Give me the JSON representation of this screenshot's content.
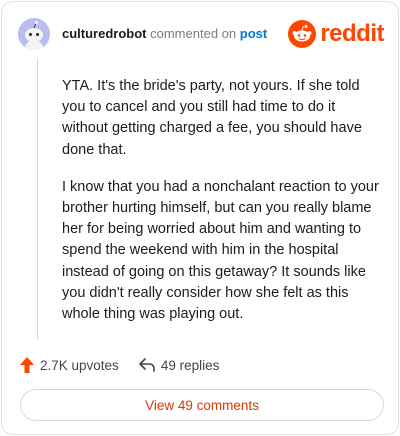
{
  "comment": {
    "username": "culturedrobot",
    "action_text": "commented on",
    "target_text": "post",
    "paragraphs": [
      "YTA. It's the bride's party, not yours. If she told you to cancel and you still had time to do it without getting charged a fee, you should have done that.",
      "I know that you had a nonchalant reaction to your brother hurting himself, but can you really blame her for being worried about him and wanting to spend the weekend with him in the hospital instead of going on this getaway? It sounds like you didn't really consider how she felt as this whole thing was playing out."
    ]
  },
  "brand": {
    "wordmark": "reddit",
    "color": "#ff4500"
  },
  "actions": {
    "upvotes_label": "2.7K upvotes",
    "replies_label": "49 replies"
  },
  "view_button_label": "View 49 comments",
  "colors": {
    "accent": "#ff4500",
    "link": "#0079d3",
    "button_text": "#d93a00"
  }
}
